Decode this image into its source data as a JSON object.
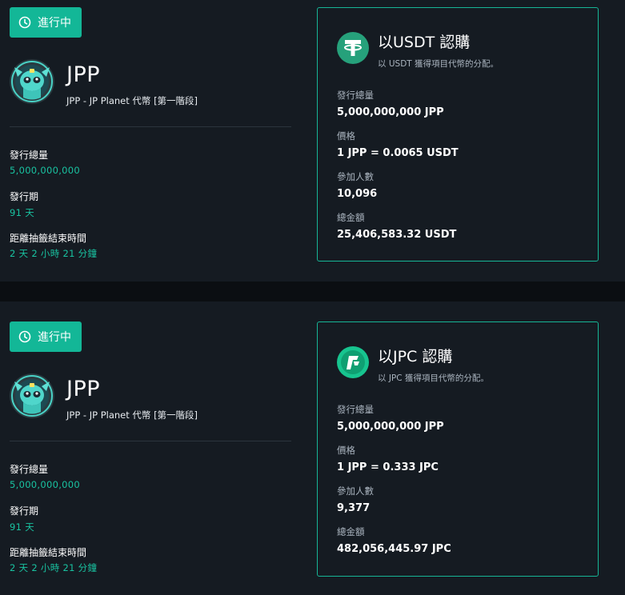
{
  "colors": {
    "accent": "#13b797",
    "panel_border": "#16b596",
    "card_bg": "#151b22",
    "page_bg": "#0b0e12"
  },
  "sales": [
    {
      "status_label": "進行中",
      "status_icon": "clock-icon",
      "token_name": "JPP",
      "token_subtitle": "JPP - JP Planet 代幣 [第一階段]",
      "stats": {
        "supply_label": "發行總量",
        "supply_value": "5,000,000,000",
        "period_label": "發行期",
        "period_value": "91 天",
        "countdown_label": "距離抽籤結束時間",
        "countdown_value": "2 天 2 小時 21 分鐘"
      },
      "panel": {
        "logo_icon": "tether-icon",
        "title": "以USDT 認購",
        "description": "以 USDT 獲得項目代幣的分配。",
        "supply_label": "發行總量",
        "supply_value": "5,000,000,000 JPP",
        "price_label": "價格",
        "price_value": "1 JPP = 0.0065 USDT",
        "participants_label": "參加人數",
        "participants_value": "10,096",
        "total_label": "總金額",
        "total_value": "25,406,583.32 USDT"
      }
    },
    {
      "status_label": "進行中",
      "status_icon": "clock-icon",
      "token_name": "JPP",
      "token_subtitle": "JPP - JP Planet 代幣 [第一階段]",
      "stats": {
        "supply_label": "發行總量",
        "supply_value": "5,000,000,000",
        "period_label": "發行期",
        "period_value": "91 天",
        "countdown_label": "距離抽籤結束時間",
        "countdown_value": "2 天 2 小時 21 分鐘"
      },
      "panel": {
        "logo_icon": "jpc-icon",
        "title": "以JPC 認購",
        "description": "以 JPC 獲得項目代幣的分配。",
        "supply_label": "發行總量",
        "supply_value": "5,000,000,000 JPP",
        "price_label": "價格",
        "price_value": "1 JPP = 0.333 JPC",
        "participants_label": "參加人數",
        "participants_value": "9,377",
        "total_label": "總金額",
        "total_value": "482,056,445.97 JPC"
      }
    }
  ]
}
